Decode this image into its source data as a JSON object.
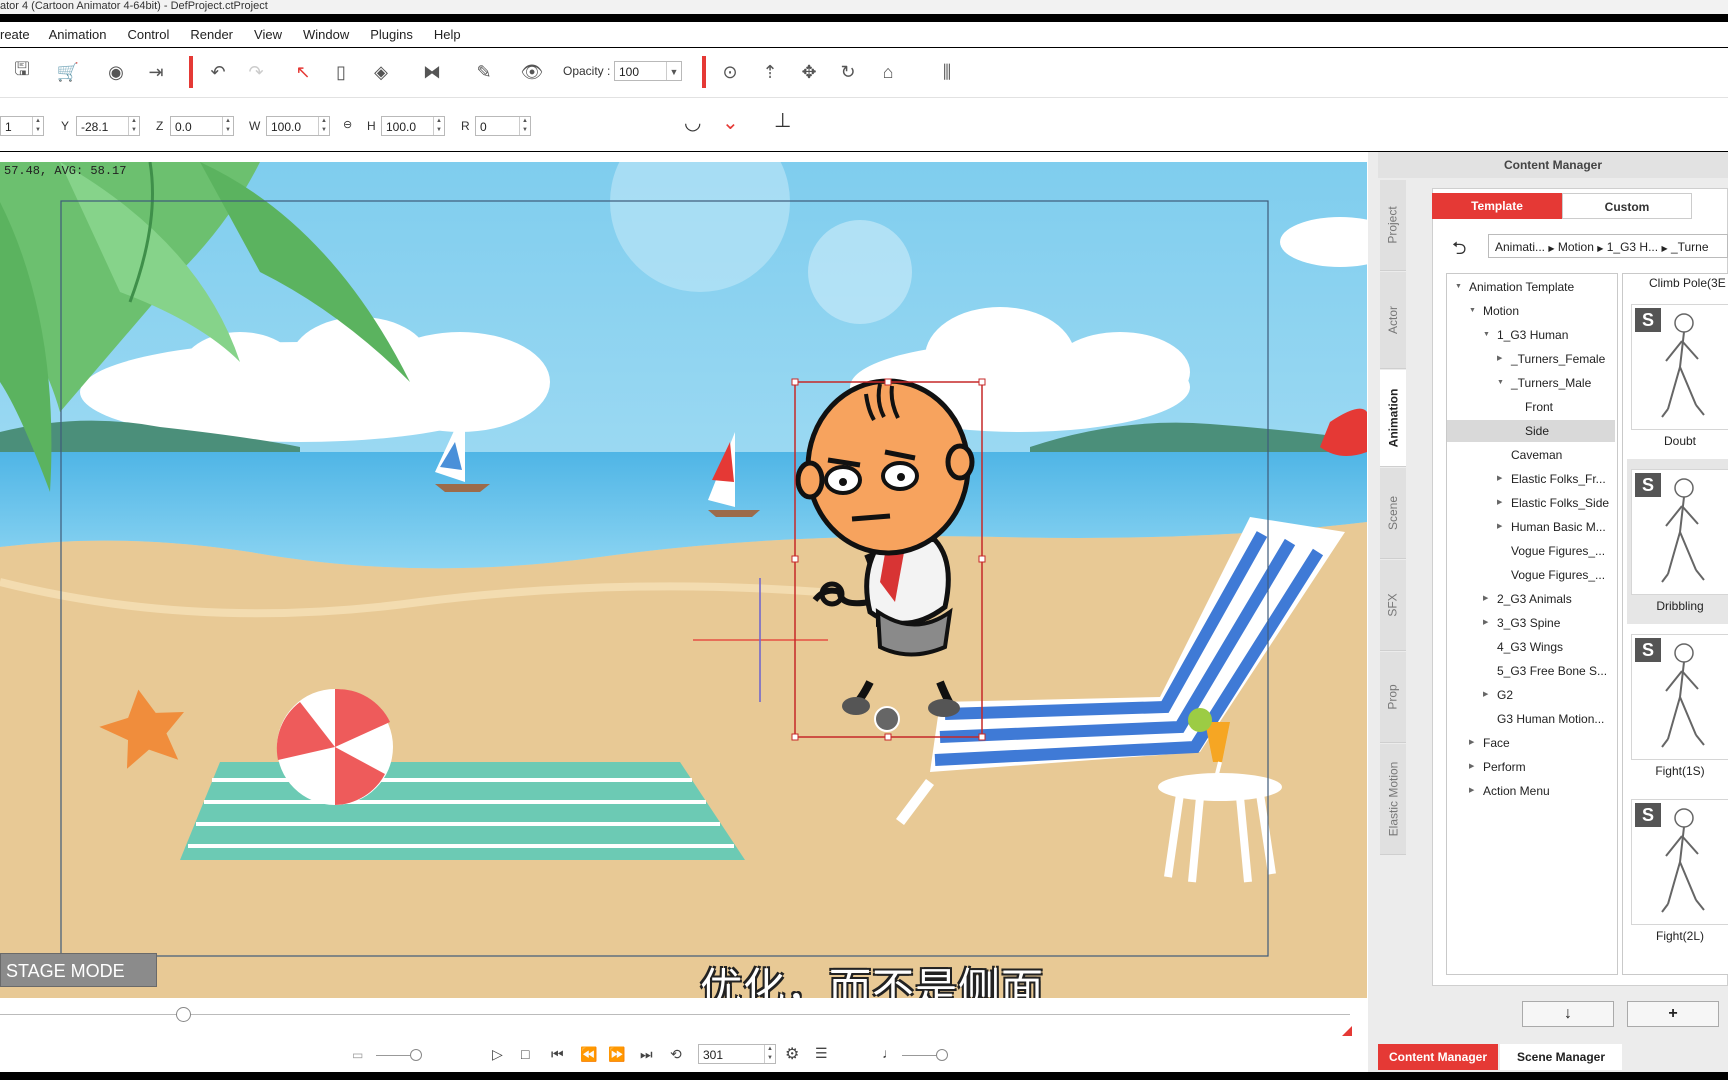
{
  "window": {
    "title": "ator 4 (Cartoon Animator 4-64bit) - DefProject.ctProject"
  },
  "menu": [
    "reate",
    "Animation",
    "Control",
    "Render",
    "View",
    "Window",
    "Plugins",
    "Help"
  ],
  "toolbar": {
    "opacity_label": "Opacity :",
    "opacity_value": "100"
  },
  "transform": {
    "x_value": "1",
    "y_label": "Y",
    "y_value": "-28.1",
    "z_label": "Z",
    "z_value": "0.0",
    "w_label": "W",
    "w_value": "100.0",
    "h_label": "H",
    "h_value": "100.0",
    "r_label": "R",
    "r_value": "0"
  },
  "stage": {
    "fps_text": "57.48, AVG: 58.17",
    "mode_label": "STAGE MODE",
    "subtitle": "优化，而不是侧面"
  },
  "timeline": {
    "frame_value": "301",
    "slider_fraction": 0.13
  },
  "side_tabs": [
    "Project",
    "Actor",
    "Animation",
    "Scene",
    "SFX",
    "Prop",
    "Elastic Motion"
  ],
  "content_manager": {
    "title": "Content Manager",
    "tabs": {
      "template": "Template",
      "custom": "Custom"
    },
    "breadcrumb": [
      "Animati...",
      "Motion",
      "1_G3 H...",
      "_Turne"
    ],
    "tree": [
      {
        "label": "Animation Template",
        "level": 0,
        "arrow": "open"
      },
      {
        "label": "Motion",
        "level": 1,
        "arrow": "open"
      },
      {
        "label": "1_G3 Human",
        "level": 2,
        "arrow": "open"
      },
      {
        "label": "_Turners_Female",
        "level": 3,
        "arrow": "closed"
      },
      {
        "label": "_Turners_Male",
        "level": 3,
        "arrow": "open"
      },
      {
        "label": "Front",
        "level": 4,
        "arrow": "none"
      },
      {
        "label": "Side",
        "level": 4,
        "arrow": "none",
        "selected": true
      },
      {
        "label": "Caveman",
        "level": 3,
        "arrow": "none"
      },
      {
        "label": "Elastic Folks_Fr...",
        "level": 3,
        "arrow": "closed"
      },
      {
        "label": "Elastic Folks_Side",
        "level": 3,
        "arrow": "closed"
      },
      {
        "label": "Human Basic M...",
        "level": 3,
        "arrow": "closed"
      },
      {
        "label": "Vogue Figures_...",
        "level": 3,
        "arrow": "none"
      },
      {
        "label": "Vogue Figures_...",
        "level": 3,
        "arrow": "none"
      },
      {
        "label": "2_G3 Animals",
        "level": 2,
        "arrow": "closed"
      },
      {
        "label": "3_G3 Spine",
        "level": 2,
        "arrow": "closed"
      },
      {
        "label": "4_G3 Wings",
        "level": 2,
        "arrow": "none"
      },
      {
        "label": "5_G3 Free Bone S...",
        "level": 2,
        "arrow": "none"
      },
      {
        "label": "G2",
        "level": 2,
        "arrow": "closed"
      },
      {
        "label": "G3 Human Motion...",
        "level": 2,
        "arrow": "none"
      },
      {
        "label": "Face",
        "level": 1,
        "arrow": "closed"
      },
      {
        "label": "Perform",
        "level": 1,
        "arrow": "closed"
      },
      {
        "label": "Action Menu",
        "level": 1,
        "arrow": "closed"
      }
    ],
    "thumbs_header": "Climb Pole(3E",
    "thumbs": [
      {
        "label": "Doubt",
        "badge": "S"
      },
      {
        "label": "Dribbling",
        "badge": "S"
      },
      {
        "label": "Fight(1S)",
        "badge": "S"
      },
      {
        "label": "Fight(2L)",
        "badge": "S"
      }
    ],
    "bottom_tabs": {
      "content_manager": "Content Manager",
      "scene_manager": "Scene Manager"
    }
  },
  "colors": {
    "accent": "#e53935",
    "sky": "#8fd3f0",
    "sand": "#e8c995",
    "selection": "#c62828"
  }
}
